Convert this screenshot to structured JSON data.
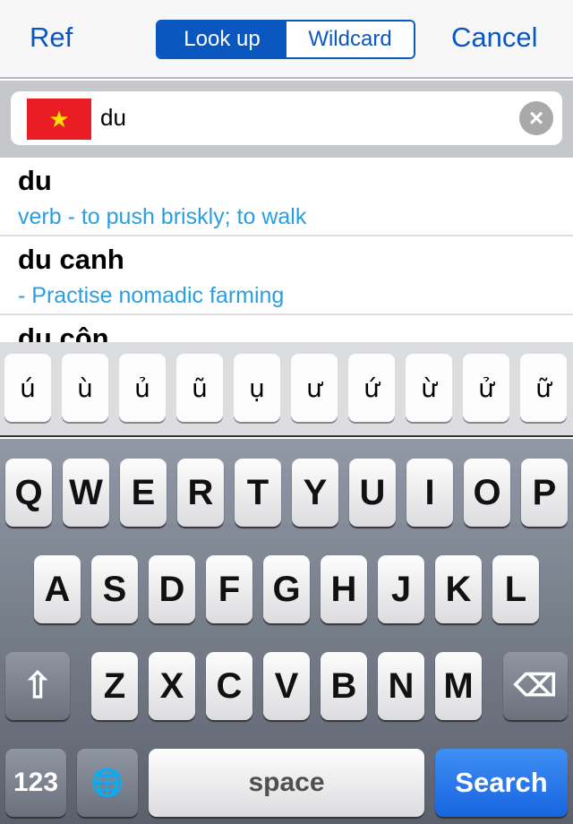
{
  "nav": {
    "left": "Ref",
    "segments": [
      "Look up",
      "Wildcard"
    ],
    "right": "Cancel",
    "accent": "#0b57c0"
  },
  "search": {
    "value": "du",
    "flag_icon": "vietnam-flag",
    "clear_icon": "clear-x"
  },
  "results": [
    {
      "word": "du",
      "def": "verb - to push briskly; to walk"
    },
    {
      "word": "du canh",
      "def": "- Practise nomadic farming"
    },
    {
      "word": "du côn",
      "def": ""
    }
  ],
  "accent_keys": [
    "ú",
    "ù",
    "ủ",
    "ũ",
    "ụ",
    "ư",
    "ứ",
    "ừ",
    "ử",
    "ữ"
  ],
  "keyboard": {
    "row1": [
      "Q",
      "W",
      "E",
      "R",
      "T",
      "Y",
      "U",
      "I",
      "O",
      "P"
    ],
    "row2": [
      "A",
      "S",
      "D",
      "F",
      "G",
      "H",
      "J",
      "K",
      "L"
    ],
    "row3": [
      "Z",
      "X",
      "C",
      "V",
      "B",
      "N",
      "M"
    ],
    "shift": "⇧",
    "delete": "⌫",
    "numbers": "123",
    "globe": "🌐",
    "space": "space",
    "search": "Search"
  }
}
